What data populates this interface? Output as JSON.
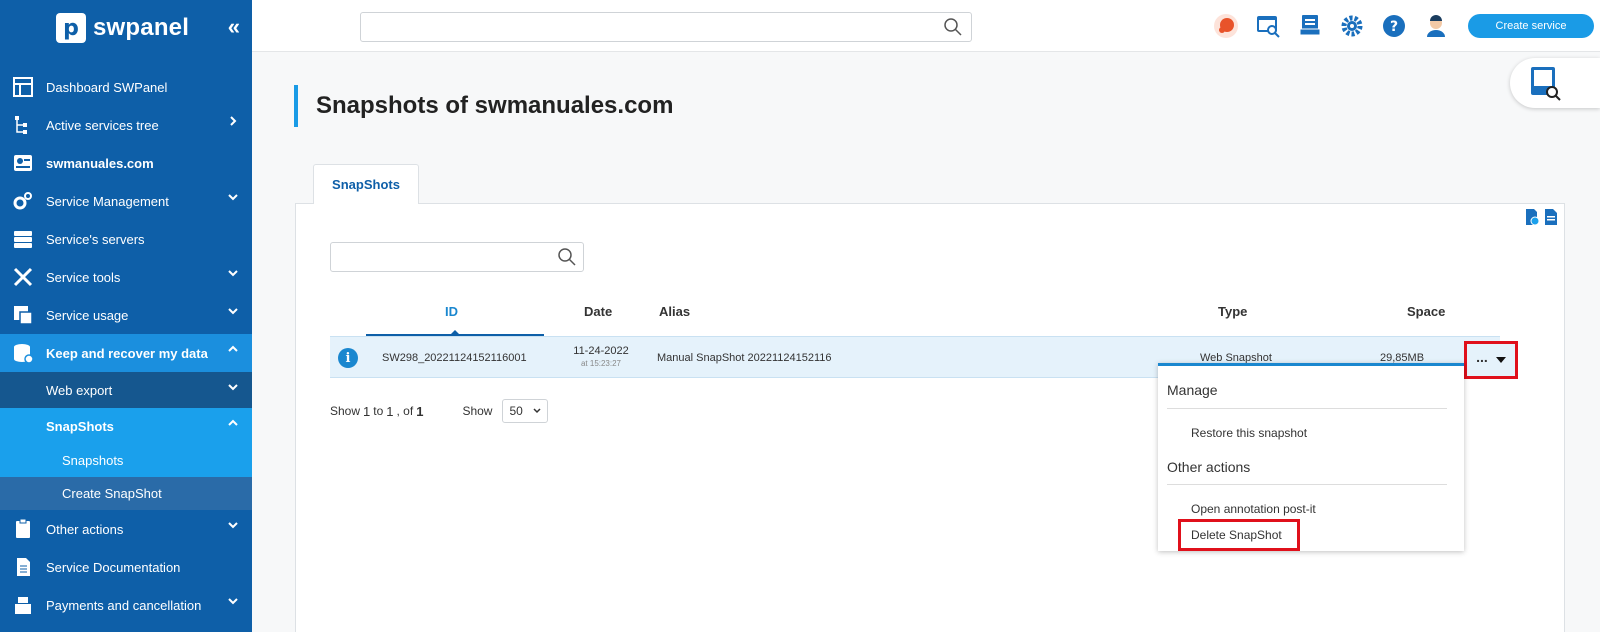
{
  "app": {
    "logo_letter": "p",
    "logo_text": "swpanel",
    "collapse_glyph": "«"
  },
  "sidebar": {
    "items": [
      {
        "label": "Dashboard SWPanel",
        "icon": "dashboard-icon"
      },
      {
        "label": "Active services tree",
        "icon": "tree-icon"
      },
      {
        "label": "swmanuales.com",
        "icon": "domain-icon"
      },
      {
        "label": "Service Management",
        "icon": "gears-icon"
      },
      {
        "label": "Service's servers",
        "icon": "server-icon"
      },
      {
        "label": "Service tools",
        "icon": "tools-icon"
      },
      {
        "label": "Service usage",
        "icon": "usage-icon"
      },
      {
        "label": "Keep and recover my data",
        "icon": "database-icon"
      },
      {
        "label": "Web export"
      },
      {
        "label": "SnapShots"
      },
      {
        "label": "Snapshots"
      },
      {
        "label": "Create SnapShot"
      },
      {
        "label": "Other actions",
        "icon": "clipboard-icon"
      },
      {
        "label": "Service Documentation",
        "icon": "document-icon"
      },
      {
        "label": "Payments and cancellation",
        "icon": "cash-register-icon"
      }
    ]
  },
  "topbar": {
    "search_placeholder": "",
    "create_label": "Create service"
  },
  "page": {
    "title_prefix": "Snapshots of ",
    "title_domain": "swmanuales.com"
  },
  "tabs": [
    {
      "label": "SnapShots"
    }
  ],
  "table": {
    "search_placeholder": "",
    "columns": {
      "id": "ID",
      "date": "Date",
      "alias": "Alias",
      "type": "Type",
      "space": "Space"
    },
    "rows": [
      {
        "id": "SW298_20221124152116001",
        "date": "11-24-2022",
        "time": "at 15:23:27",
        "alias": "Manual SnapShot 20221124152116",
        "type": "Web Snapshot",
        "space": "29,85MB",
        "actions": "..."
      }
    ]
  },
  "pager": {
    "show_label": "Show",
    "from": "1",
    "to_word": "to",
    "to": "1",
    "of_word": ", of",
    "total": "1",
    "per_page_label": "Show",
    "per_page": "50"
  },
  "dropdown": {
    "manage_header": "Manage",
    "restore": "Restore this snapshot",
    "other_header": "Other actions",
    "annotation": "Open annotation post-it",
    "delete": "Delete SnapShot"
  },
  "colors": {
    "sidebar": "#0e5fa8",
    "accent": "#1a9be6",
    "highlight": "#e0101b"
  }
}
